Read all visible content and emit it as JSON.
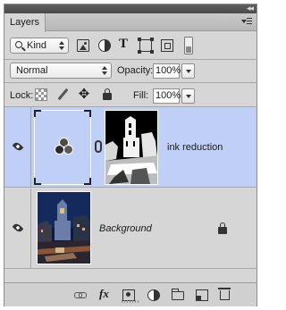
{
  "panel": {
    "tab_label": "Layers",
    "collapse_glyph": "◂◂"
  },
  "filter": {
    "kind_label": "Kind",
    "icons": [
      "image-filter-icon",
      "adjustment-filter-icon",
      "type-filter-icon",
      "shape-filter-icon",
      "smart-object-filter-icon",
      "filter-toggle-icon"
    ],
    "type_glyph": "T"
  },
  "blend": {
    "mode": "Normal",
    "opacity_label": "Opacity:",
    "opacity_value": "100%"
  },
  "lock": {
    "label": "Lock:",
    "fill_label": "Fill:",
    "fill_value": "100%",
    "move_glyph": "✥"
  },
  "layers": [
    {
      "name": "ink reduction",
      "selected": true,
      "type": "adjustment",
      "visible": true
    },
    {
      "name": "Background",
      "selected": false,
      "type": "image",
      "visible": true,
      "locked": true
    }
  ],
  "bottom": {
    "fx_label": "fx"
  },
  "colors": {
    "panel_bg": "#d6d6d6",
    "selected_row": "#bfcff5"
  }
}
